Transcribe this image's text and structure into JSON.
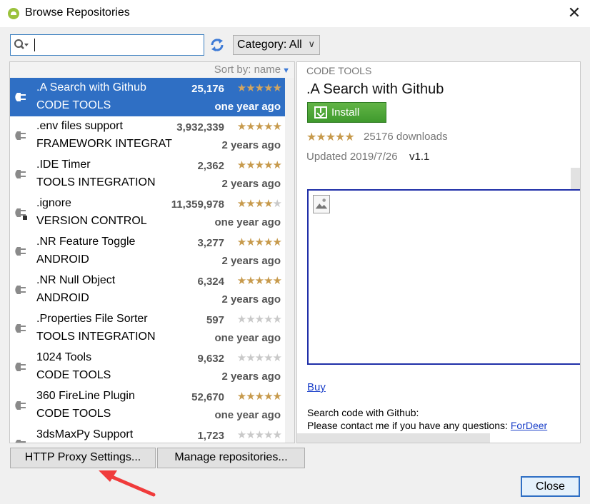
{
  "window": {
    "title": "Browse Repositories",
    "close_glyph": "✕"
  },
  "search": {
    "value": "",
    "category_label": "Category: All"
  },
  "list": {
    "sort_label": "Sort by: name",
    "items": [
      {
        "name": ".A Search with Github",
        "category": "CODE TOOLS",
        "downloads": "25,176",
        "stars": "★★★★",
        "stars_off": "",
        "half": "★",
        "date": "one year ago",
        "selected": true
      },
      {
        "name": ".env files support",
        "category": "FRAMEWORK INTEGRATIO",
        "downloads": "3,932,339",
        "stars": "★★★★★",
        "stars_off": "",
        "half": "",
        "date": "2 years ago"
      },
      {
        "name": ".IDE Timer",
        "category": "TOOLS INTEGRATION",
        "downloads": "2,362",
        "stars": "★★★★",
        "stars_off": "",
        "half": "★",
        "date": "2 years ago"
      },
      {
        "name": ".ignore",
        "category": "VERSION CONTROL",
        "downloads": "11,359,978",
        "stars": "★★★★",
        "stars_off": "★",
        "half": "",
        "date": "one year ago"
      },
      {
        "name": ".NR Feature Toggle",
        "category": "ANDROID",
        "downloads": "3,277",
        "stars": "★★★★",
        "stars_off": "",
        "half": "★",
        "date": "2 years ago"
      },
      {
        "name": ".NR Null Object",
        "category": "ANDROID",
        "downloads": "6,324",
        "stars": "★★★★",
        "stars_off": "",
        "half": "★",
        "date": "2 years ago"
      },
      {
        "name": ".Properties File Sorter",
        "category": "TOOLS INTEGRATION",
        "downloads": "597",
        "stars": "",
        "stars_off": "★★★★★",
        "half": "",
        "date": "one year ago"
      },
      {
        "name": "1024 Tools",
        "category": "CODE TOOLS",
        "downloads": "9,632",
        "stars": "",
        "stars_off": "★★★★★",
        "half": "",
        "date": "2 years ago"
      },
      {
        "name": "360 FireLine Plugin",
        "category": "CODE TOOLS",
        "downloads": "52,670",
        "stars": "★★★★",
        "stars_off": "",
        "half": "★",
        "date": "one year ago"
      },
      {
        "name": "3dsMaxPy Support",
        "category": "",
        "downloads": "1,723",
        "stars": "",
        "stars_off": "★★★★★",
        "half": "",
        "date": ""
      }
    ]
  },
  "detail": {
    "category": "CODE TOOLS",
    "title": ".A Search with Github",
    "install_label": "Install",
    "stars": "★★★★",
    "half": "★",
    "downloads": "25176 downloads",
    "updated": "Updated 2019/7/26",
    "version": "v1.1",
    "buy_label": "Buy",
    "desc_line1": "Search code with Github:",
    "desc_line2": "Please contact me if you have any questions: ",
    "contact_link": "ForDeer"
  },
  "buttons": {
    "proxy": "HTTP Proxy Settings...",
    "repos": "Manage repositories...",
    "close": "Close"
  }
}
